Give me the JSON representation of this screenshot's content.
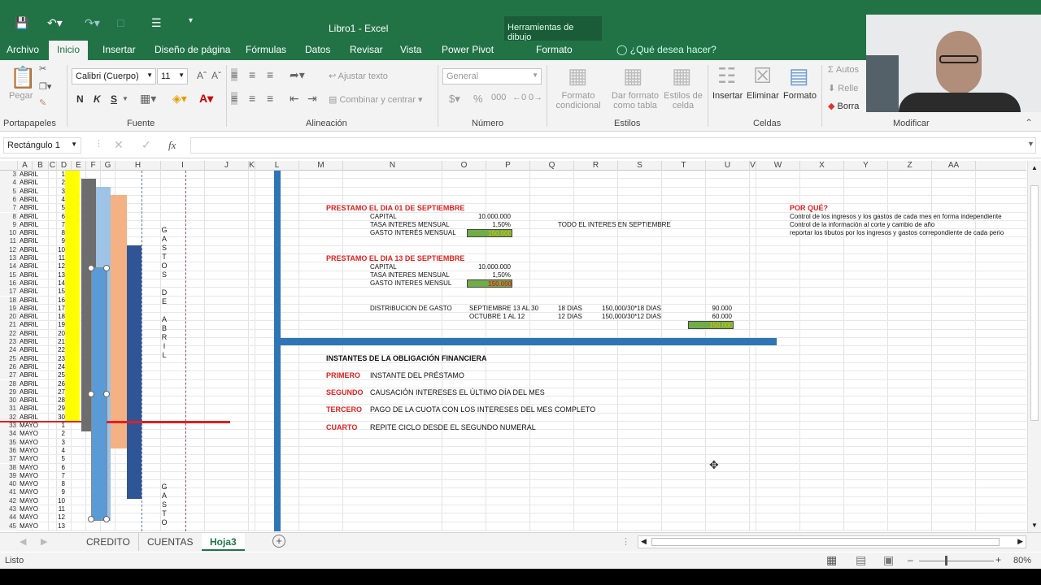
{
  "title": "Libro1 - Excel",
  "drawing_tools": "Herramientas de dibujo",
  "tabs": [
    "Archivo",
    "Inicio",
    "Insertar",
    "Diseño de página",
    "Fórmulas",
    "Datos",
    "Revisar",
    "Vista",
    "Power Pivot",
    "Formato"
  ],
  "tell_me": "¿Qué desea hacer?",
  "ribbon": {
    "paste": "Pegar",
    "font_name": "Calibri (Cuerpo)",
    "font_size": "11",
    "wrap": "Ajustar texto",
    "merge": "Combinar y centrar",
    "num_format": "General",
    "cond_format": "Formato condicional",
    "table_format": "Dar formato como tabla",
    "cell_styles": "Estilos de celda",
    "insert": "Insertar",
    "delete": "Eliminar",
    "format": "Formato",
    "autosum": "Autos",
    "fill": "Relle",
    "clear": "Borra",
    "groups": [
      "Portapapeles",
      "Fuente",
      "Alineación",
      "Número",
      "Estilos",
      "Celdas",
      "Modificar"
    ]
  },
  "name_box": "Rectángulo 1",
  "fx": "fx",
  "columns": [
    "A",
    "B",
    "C",
    "D",
    "E",
    "F",
    "G",
    "H",
    "I",
    "J",
    "K",
    "L",
    "M",
    "N",
    "O",
    "P",
    "Q",
    "R",
    "S",
    "T",
    "U",
    "V",
    "W",
    "X",
    "Y",
    "Z",
    "AA"
  ],
  "rows_a": [
    "ABRIL",
    "ABRIL",
    "ABRIL",
    "ABRIL",
    "ABRIL",
    "ABRIL",
    "ABRIL",
    "ABRIL",
    "ABRIL",
    "ABRIL",
    "ABRIL",
    "ABRIL",
    "ABRIL",
    "ABRIL",
    "ABRIL",
    "ABRIL",
    "ABRIL",
    "ABRIL",
    "ABRIL",
    "ABRIL",
    "ABRIL",
    "ABRIL",
    "ABRIL",
    "ABRIL",
    "ABRIL",
    "ABRIL",
    "ABRIL",
    "ABRIL",
    "ABRIL",
    "ABRIL",
    "MAYO",
    "MAYO",
    "MAYO",
    "MAYO",
    "MAYO",
    "MAYO",
    "MAYO",
    "MAYO",
    "MAYO",
    "MAYO",
    "MAYO",
    "MAYO",
    "MAYO"
  ],
  "rows_b": [
    "1",
    "2",
    "3",
    "4",
    "5",
    "6",
    "7",
    "8",
    "9",
    "10",
    "11",
    "12",
    "13",
    "14",
    "15",
    "16",
    "17",
    "18",
    "19",
    "20",
    "21",
    "22",
    "23",
    "24",
    "25",
    "26",
    "27",
    "28",
    "29",
    "30",
    "1",
    "2",
    "3",
    "4",
    "5",
    "6",
    "7",
    "8",
    "9",
    "10",
    "11",
    "12",
    "13"
  ],
  "vertical_text_1": [
    "G",
    "A",
    "S",
    "T",
    "O",
    "S",
    "",
    "D",
    "E",
    "",
    "A",
    "B",
    "R",
    "I",
    "L"
  ],
  "vertical_text_2": [
    "G",
    "A",
    "S",
    "T",
    "O"
  ],
  "content": {
    "p1_title": "PRESTAMO EL DIA 01 DE SEPTIEMBRE",
    "capital": "CAPITAL",
    "capital_val": "10.000.000",
    "tasa": "TASA INTERES MENSUAL",
    "tasa_val": "1,50%",
    "todo": "TODO EL INTERES EN SEPTIEMBRE",
    "gasto1": "GASTO INTERÉS MENSUAL",
    "gasto_val": "150.000",
    "p2_title": "PRESTAMO EL DIA 13 DE SEPTIEMBRE",
    "gasto2": "GASTO INTERES MENSUL",
    "distrib": "DISTRIBUCION DE GASTO",
    "sep": "SEPTIEMBRE 13 AL 30",
    "oct": "OCTUBRE 1 AL 12",
    "d18": "18 DIAS",
    "d12": "12 DIAS",
    "f18": "150,000/30*18 DIAS",
    "f12": "150,000/30*12 DIAS",
    "v90": "90.000",
    "v60": "60.000",
    "instantes": "INSTANTES DE LA OBLIGACIÓN FINANCIERA",
    "primero": "PRIMERO",
    "primero_t": "INSTANTE DEL PRÉSTAMO",
    "segundo": "SEGUNDO",
    "segundo_t": "CAUSACIÓN INTERESES EL ÚLTIMO DÍA DEL MES",
    "tercero": "TERCERO",
    "tercero_t": "PAGO DE LA CUOTA CON LOS INTERESES DEL MES COMPLETO",
    "cuarto": "CUARTO",
    "cuarto_t": "REPITE CICLO DESDE EL SEGUNDO NUMERAL",
    "porque": "POR QUÉ?",
    "note1": "Control de los ingresos y los gastos de cada mes en forma independiente",
    "note2": "Control de la información al corte y cambio de año",
    "note3": "reportar los tibutos por los ingresos y gastos correpondiente de cada perio"
  },
  "sheets": [
    "CREDITO",
    "CUENTAS",
    "Hoja3"
  ],
  "status": "Listo",
  "zoom": "80%"
}
